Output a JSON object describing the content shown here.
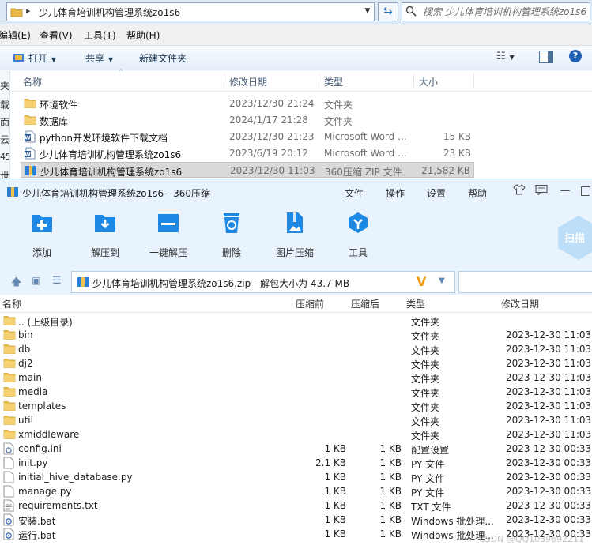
{
  "explorer": {
    "path": "少儿体育培训机构管理系统zo1s6",
    "search_placeholder": "搜索 少儿体育培训机构管理系统zo1s6",
    "menu": [
      "编辑(E)",
      "查看(V)",
      "工具(T)",
      "帮助(H)"
    ],
    "commands": {
      "open": "打开",
      "share": "共享",
      "new_folder": "新建文件夹"
    },
    "left_edge_chars": [
      "夹",
      "载",
      "面",
      "云",
      "45",
      "世"
    ],
    "columns": {
      "name": "名称",
      "modified": "修改日期",
      "type": "类型",
      "size": "大小"
    },
    "files": [
      {
        "name": "环境软件",
        "date": "2023/12/30 21:24",
        "type": "文件夹",
        "size": "",
        "icon": "folder-icon"
      },
      {
        "name": "数据库",
        "date": "2024/1/17 21:28",
        "type": "文件夹",
        "size": "",
        "icon": "folder-icon"
      },
      {
        "name": "python开发环境软件下载文档",
        "date": "2023/12/30 21:23",
        "type": "Microsoft Word ...",
        "size": "15 KB",
        "icon": "word-doc-icon"
      },
      {
        "name": "少儿体育培训机构管理系统zo1s6",
        "date": "2023/6/19 20:12",
        "type": "Microsoft Word ...",
        "size": "23 KB",
        "icon": "word-doc-icon"
      },
      {
        "name": "少儿体育培训机构管理系统zo1s6",
        "date": "2023/12/30 11:03",
        "type": "360压缩 ZIP 文件",
        "size": "21,582 KB",
        "icon": "zip-archive-icon",
        "selected": true
      }
    ]
  },
  "zip": {
    "title": "少儿体育培训机构管理系统zo1s6 - 360压缩",
    "menu": [
      "文件",
      "操作",
      "设置",
      "帮助"
    ],
    "tools": [
      "添加",
      "解压到",
      "一键解压",
      "删除",
      "图片压缩",
      "工具"
    ],
    "scan_label": "扫描",
    "path_text": "少儿体育培训机构管理系统zo1s6.zip - 解包大小为 43.7 MB",
    "columns": {
      "name": "名称",
      "compressed_before": "压缩前",
      "compressed_after": "压缩后",
      "type": "类型",
      "modified": "修改日期"
    },
    "rows": [
      {
        "name": ".. (上级目录)",
        "before": "",
        "after": "",
        "type": "文件夹",
        "date": "",
        "icon": "folder-icon"
      },
      {
        "name": "bin",
        "before": "",
        "after": "",
        "type": "文件夹",
        "date": "2023-12-30 11:03",
        "icon": "folder-icon"
      },
      {
        "name": "db",
        "before": "",
        "after": "",
        "type": "文件夹",
        "date": "2023-12-30 11:03",
        "icon": "folder-icon"
      },
      {
        "name": "dj2",
        "before": "",
        "after": "",
        "type": "文件夹",
        "date": "2023-12-30 11:03",
        "icon": "folder-icon"
      },
      {
        "name": "main",
        "before": "",
        "after": "",
        "type": "文件夹",
        "date": "2023-12-30 11:03",
        "icon": "folder-icon"
      },
      {
        "name": "media",
        "before": "",
        "after": "",
        "type": "文件夹",
        "date": "2023-12-30 11:03",
        "icon": "folder-icon"
      },
      {
        "name": "templates",
        "before": "",
        "after": "",
        "type": "文件夹",
        "date": "2023-12-30 11:03",
        "icon": "folder-icon"
      },
      {
        "name": "util",
        "before": "",
        "after": "",
        "type": "文件夹",
        "date": "2023-12-30 11:03",
        "icon": "folder-icon"
      },
      {
        "name": "xmiddleware",
        "before": "",
        "after": "",
        "type": "文件夹",
        "date": "2023-12-30 11:03",
        "icon": "folder-icon"
      },
      {
        "name": "config.ini",
        "before": "1 KB",
        "after": "1 KB",
        "type": "配置设置",
        "date": "2023-12-30 00:33",
        "icon": "settings-file-icon"
      },
      {
        "name": "init.py",
        "before": "2.1 KB",
        "after": "1 KB",
        "type": "PY 文件",
        "date": "2023-12-30 00:33",
        "icon": "file-icon"
      },
      {
        "name": "initial_hive_database.py",
        "before": "1 KB",
        "after": "1 KB",
        "type": "PY 文件",
        "date": "2023-12-30 00:33",
        "icon": "file-icon"
      },
      {
        "name": "manage.py",
        "before": "1 KB",
        "after": "1 KB",
        "type": "PY 文件",
        "date": "2023-12-30 00:33",
        "icon": "file-icon"
      },
      {
        "name": "requirements.txt",
        "before": "1 KB",
        "after": "1 KB",
        "type": "TXT 文件",
        "date": "2023-12-30 00:33",
        "icon": "text-file-icon"
      },
      {
        "name": "安装.bat",
        "before": "1 KB",
        "after": "1 KB",
        "type": "Windows 批处理...",
        "date": "2023-12-30 00:33",
        "icon": "batch-file-icon"
      },
      {
        "name": "运行.bat",
        "before": "1 KB",
        "after": "1 KB",
        "type": "Windows 批处理...",
        "date": "2023-12-30 00:33",
        "icon": "batch-file-icon"
      }
    ]
  },
  "watermark": "CSDN @QQ1039692211",
  "colors": {
    "accent": "#1e88e5",
    "zip_bg": "#e9f3fd",
    "selected_row": "#d9d9d9",
    "v_mark": "#f29b0f"
  }
}
